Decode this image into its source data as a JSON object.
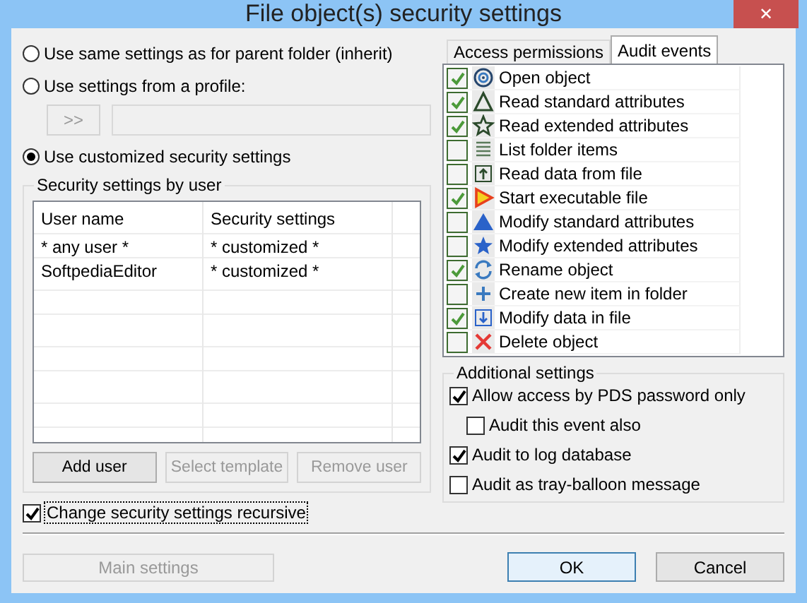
{
  "window": {
    "title": "File object(s) security settings",
    "close": "✕"
  },
  "source_options": [
    {
      "label": "Use same settings as for parent folder (inherit)",
      "selected": false
    },
    {
      "label": "Use settings from a profile:",
      "selected": false
    },
    {
      "label": "Use customized security settings",
      "selected": true
    }
  ],
  "profile": {
    "button": ">>",
    "disabled": true
  },
  "users_group": {
    "title": "Security settings by user",
    "columns": [
      "User name",
      "Security settings"
    ],
    "rows": [
      [
        "* any user *",
        "* customized *"
      ],
      [
        "SoftpediaEditor",
        "* customized *"
      ]
    ],
    "buttons": [
      {
        "label": "Add user",
        "disabled": false
      },
      {
        "label": "Select template",
        "disabled": true
      },
      {
        "label": "Remove user",
        "disabled": true
      }
    ]
  },
  "recursive": {
    "label": "Change security settings recursive",
    "checked": true
  },
  "main_settings": {
    "label": "Main settings",
    "disabled": true
  },
  "tabs": [
    {
      "label": "Access permissions",
      "selected": false
    },
    {
      "label": "Audit events",
      "selected": true
    }
  ],
  "audit_events": [
    {
      "label": "Open object",
      "checked": true,
      "kind": "target"
    },
    {
      "label": "Read standard attributes",
      "checked": true,
      "kind": "triangle-outline"
    },
    {
      "label": "Read extended attributes",
      "checked": true,
      "kind": "star-outline"
    },
    {
      "label": "List folder items",
      "checked": false,
      "kind": "lines"
    },
    {
      "label": "Read data from file",
      "checked": false,
      "kind": "upload"
    },
    {
      "label": "Start executable file",
      "checked": true,
      "kind": "play"
    },
    {
      "label": "Modify standard attributes",
      "checked": false,
      "kind": "triangle"
    },
    {
      "label": "Modify extended attributes",
      "checked": false,
      "kind": "star"
    },
    {
      "label": "Rename object",
      "checked": true,
      "kind": "refresh"
    },
    {
      "label": "Create new item in folder",
      "checked": false,
      "kind": "plus"
    },
    {
      "label": "Modify data in file",
      "checked": true,
      "kind": "download"
    },
    {
      "label": "Delete object",
      "checked": false,
      "kind": "cross"
    }
  ],
  "additional": {
    "title": "Additional settings",
    "options": [
      {
        "label": "Allow access by PDS password only",
        "checked": true,
        "children": [
          {
            "label": "Audit this event also",
            "checked": false
          }
        ]
      },
      {
        "label": "Audit to log database",
        "checked": true
      },
      {
        "label": "Audit as tray-balloon message",
        "checked": false
      }
    ]
  },
  "buttons": [
    {
      "label": "OK",
      "default": true
    },
    {
      "label": "Cancel",
      "default": false
    }
  ]
}
